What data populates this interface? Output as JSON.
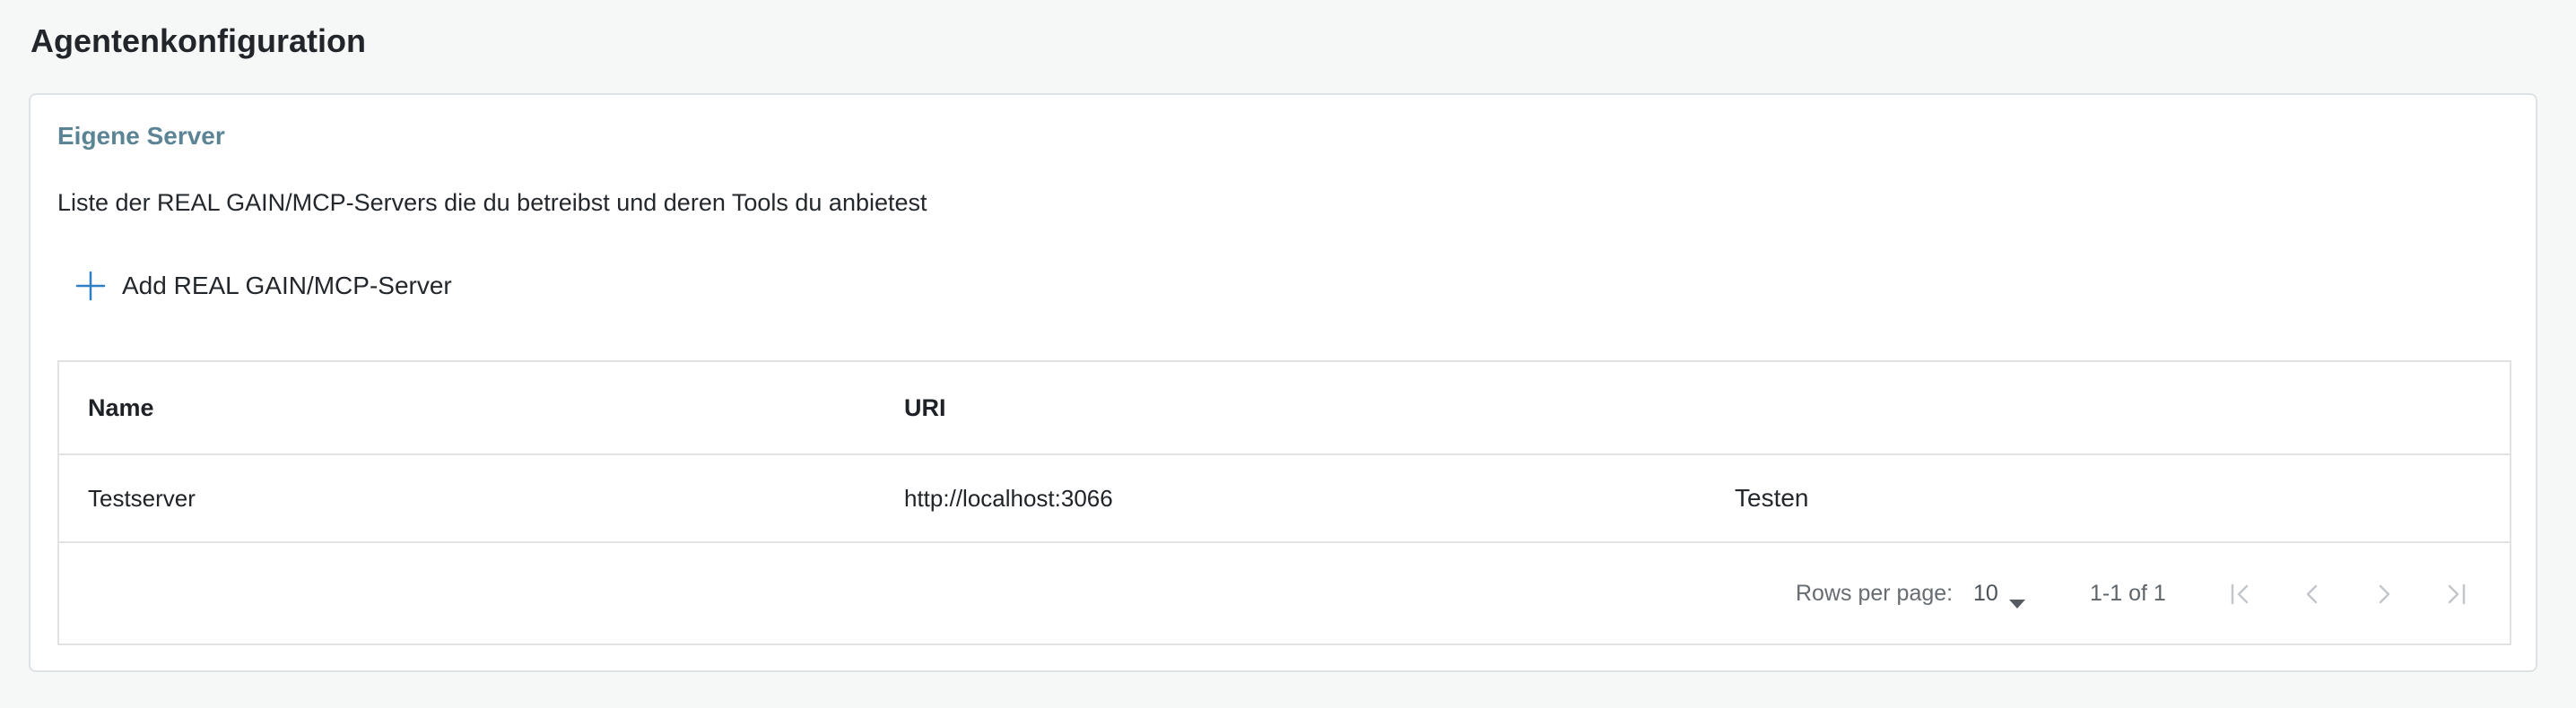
{
  "page": {
    "title": "Agentenkonfiguration"
  },
  "section": {
    "title": "Eigene Server",
    "description": "Liste der REAL GAIN/MCP-Servers die du betreibst und deren Tools du anbietest",
    "add_button_label": "Add REAL GAIN/MCP-Server",
    "add_icon": "plus-icon",
    "accent_color": "#5b8494",
    "icon_color": "#2f7fc5"
  },
  "table": {
    "columns": [
      "Name",
      "URI",
      ""
    ],
    "rows": [
      {
        "name": "Testserver",
        "uri": "http://localhost:3066",
        "action_label": "Testen"
      }
    ]
  },
  "pagination": {
    "rows_per_page_label": "Rows per page:",
    "rows_per_page_value": "10",
    "range_label": "1-1 of 1",
    "buttons": [
      {
        "name": "first-page-icon",
        "enabled": false
      },
      {
        "name": "previous-page-icon",
        "enabled": false
      },
      {
        "name": "next-page-icon",
        "enabled": false
      },
      {
        "name": "last-page-icon",
        "enabled": false
      }
    ]
  }
}
